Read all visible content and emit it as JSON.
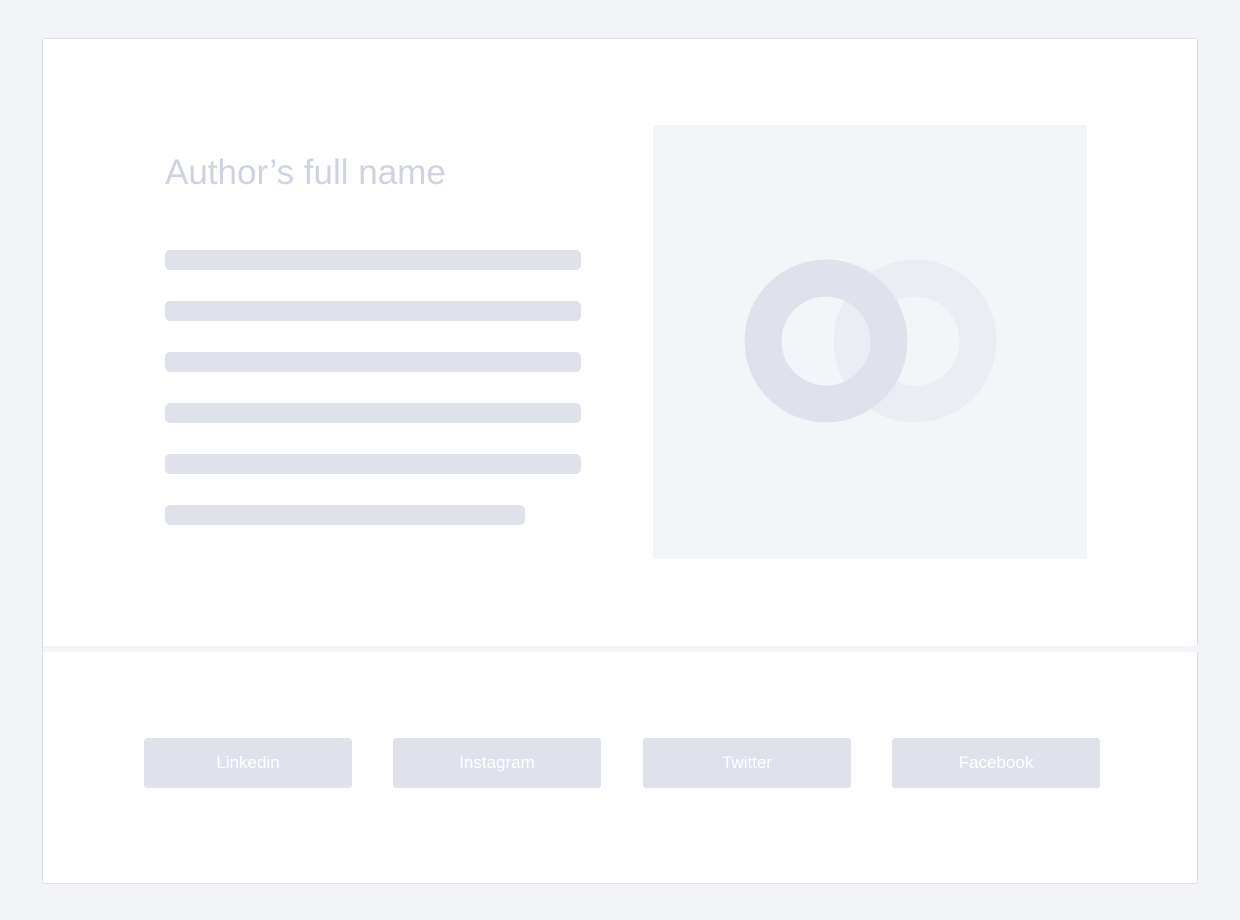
{
  "author": {
    "name": "Author’s full name"
  },
  "bio": {
    "lines": [
      {
        "length": 1.0
      },
      {
        "length": 1.0
      },
      {
        "length": 1.0
      },
      {
        "length": 1.0
      },
      {
        "length": 1.0
      },
      {
        "length": 0.865
      }
    ]
  },
  "photo": {
    "icon": "image-placeholder-icon"
  },
  "social": {
    "buttons": [
      {
        "label": "Linkedin",
        "icon": "linkedin"
      },
      {
        "label": "Instagram",
        "icon": "instagram"
      },
      {
        "label": "Twitter",
        "icon": "twitter"
      },
      {
        "label": "Facebook",
        "icon": "facebook"
      }
    ]
  },
  "colors": {
    "page_background": "#f3f4f8",
    "card_background": "#ffffff",
    "placeholder_fill": "#dfe1eb",
    "title_text": "#cfd3e1",
    "button_text": "#ffffff"
  }
}
